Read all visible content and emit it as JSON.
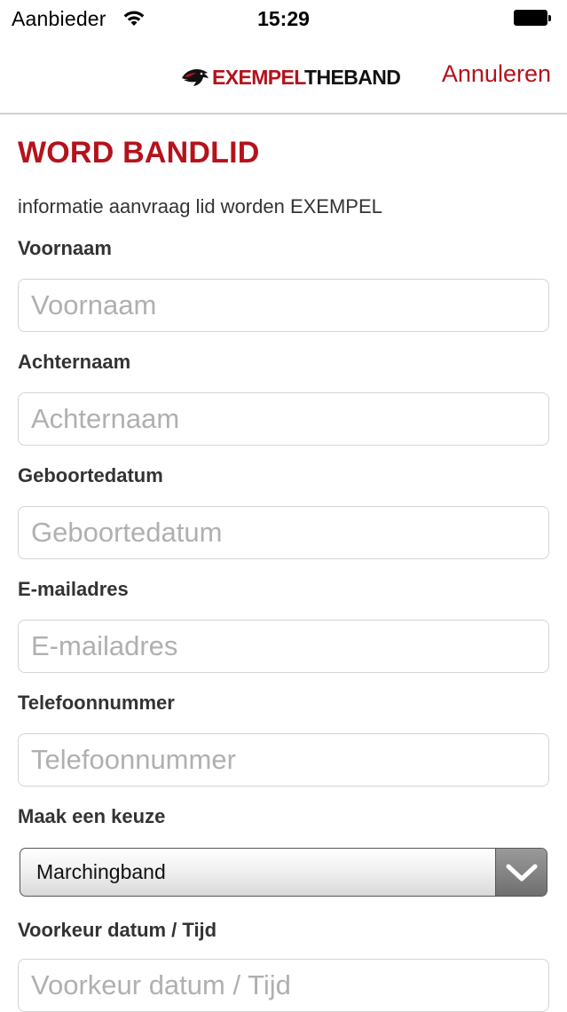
{
  "status_bar": {
    "carrier": "Aanbieder",
    "time": "15:29",
    "wifi_icon": "wifi-icon",
    "battery_icon": "battery-icon"
  },
  "nav": {
    "logo_red": "EXEMPEL",
    "logo_black": "THEBAND",
    "logo_icon": "bird-logo-icon",
    "cancel_label": "Annuleren"
  },
  "form": {
    "title": "WORD BANDLID",
    "subtitle": "informatie aanvraag lid worden EXEMPEL",
    "fields": [
      {
        "label": "Voornaam",
        "placeholder": "Voornaam"
      },
      {
        "label": "Achternaam",
        "placeholder": "Achternaam"
      },
      {
        "label": "Geboortedatum",
        "placeholder": "Geboortedatum"
      },
      {
        "label": "E-mailadres",
        "placeholder": "E-mailadres"
      },
      {
        "label": "Telefoonnummer",
        "placeholder": "Telefoonnummer"
      }
    ],
    "choice": {
      "label": "Maak een keuze",
      "selected": "Marchingband",
      "arrow_icon": "chevron-down-icon"
    },
    "preferred": {
      "label": "Voorkeur datum / Tijd",
      "placeholder": "Voorkeur datum / Tijd"
    }
  },
  "colors": {
    "accent": "#b5121b",
    "label": "#333333",
    "placeholder": "#b0b0b0",
    "input_border": "#d4d4d4"
  }
}
